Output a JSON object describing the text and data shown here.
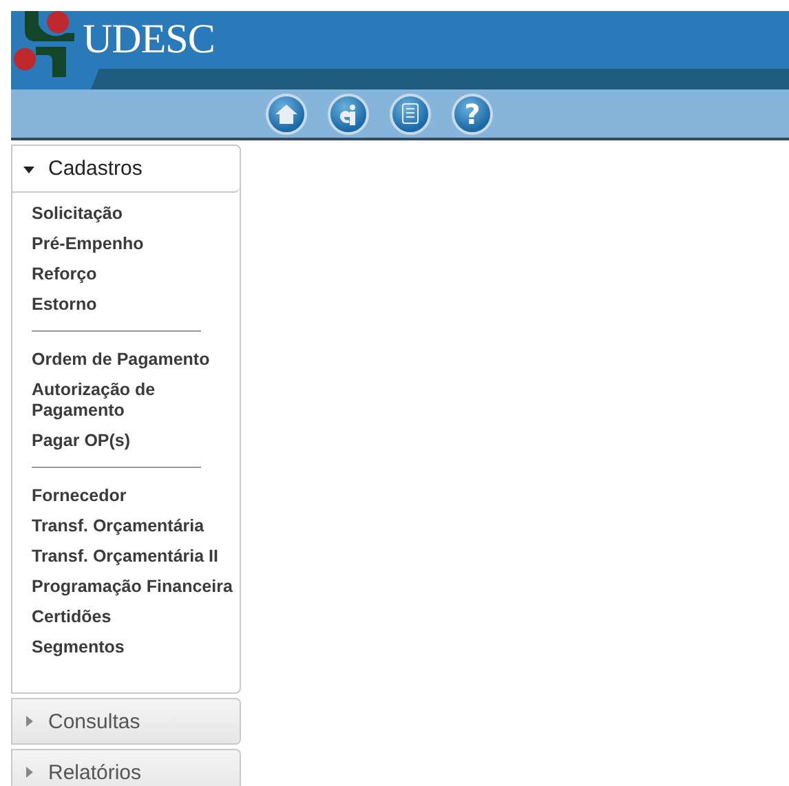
{
  "header": {
    "logo_text": "UDESC"
  },
  "toolbar": [
    {
      "kind": "home"
    },
    {
      "kind": "info"
    },
    {
      "kind": "document"
    },
    {
      "kind": "help",
      "label": "?"
    }
  ],
  "sidebar": {
    "sections": [
      {
        "label": "Cadastros",
        "expanded": true,
        "groups": [
          [
            "Solicitação",
            "Pré-Empenho",
            "Reforço",
            "Estorno"
          ],
          [
            "Ordem de Pagamento",
            "Autorização de Pagamento",
            "Pagar OP(s)"
          ],
          [
            "Fornecedor",
            "Transf. Orçamentária",
            "Transf. Orçamentária II",
            "Programação Financeira",
            "Certidões",
            "Segmentos"
          ]
        ]
      },
      {
        "label": "Consultas",
        "expanded": false
      },
      {
        "label": "Relatórios",
        "expanded": false
      }
    ]
  }
}
